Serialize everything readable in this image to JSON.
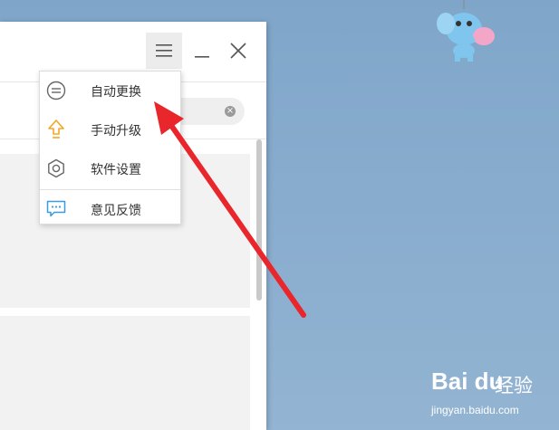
{
  "menu": {
    "items": [
      {
        "label": "自动更换",
        "icon": "swap-icon"
      },
      {
        "label": "手动升级",
        "icon": "upgrade-arrow-icon"
      },
      {
        "label": "软件设置",
        "icon": "gear-icon"
      },
      {
        "label": "意见反馈",
        "icon": "chat-feedback-icon"
      }
    ]
  },
  "titlebar": {
    "buttons": [
      "menu-icon",
      "minimize-icon",
      "close-icon"
    ]
  },
  "watermark": {
    "brand": "Bai du",
    "cn": "经验",
    "url": "jingyan.baidu.com"
  },
  "colors": {
    "arrow": "#e8262b",
    "upgrade_icon": "#f5a623",
    "feedback_icon": "#3a9be0",
    "desktop": "#88acce"
  }
}
